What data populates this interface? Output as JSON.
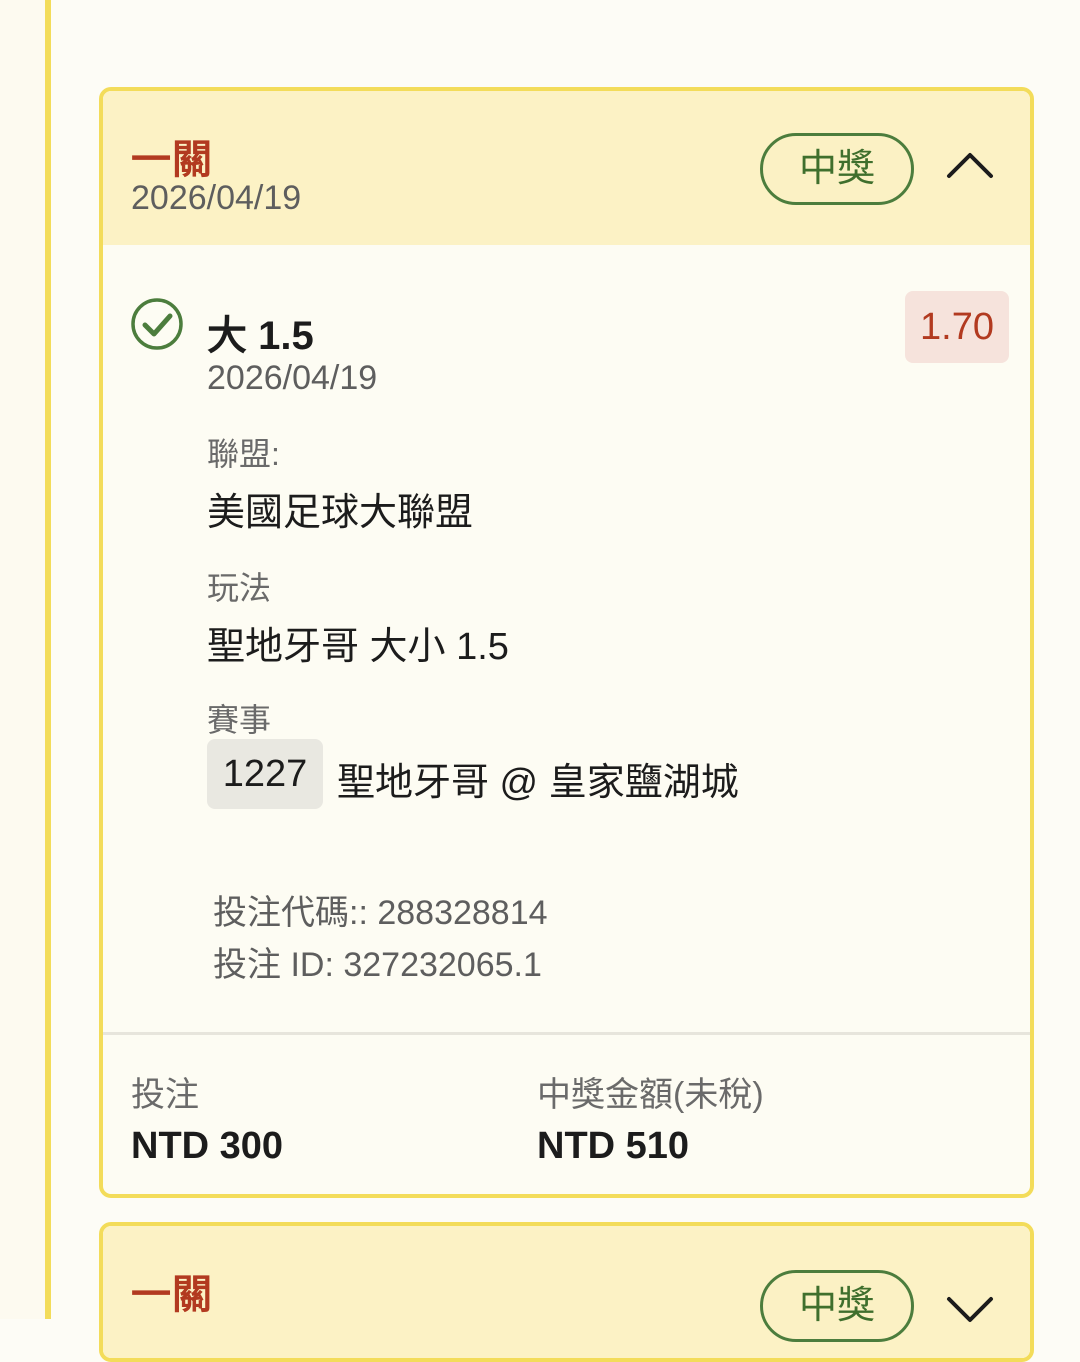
{
  "tickets": [
    {
      "type": "一關",
      "date": "2026/04/19",
      "status": "中獎",
      "expanded": true,
      "selection": {
        "title": "大 1.5",
        "date": "2026/04/19",
        "odds": "1.70",
        "league_label": "聯盟:",
        "league_value": "美國足球大聯盟",
        "market_label": "玩法",
        "market_value": "聖地牙哥 大小 1.5",
        "event_label": "賽事",
        "event_id": "1227",
        "event_name": "聖地牙哥 @ 皇家鹽湖城"
      },
      "bet_code": "投注代碼:: 288328814",
      "bet_id": "投注 ID: 327232065.1",
      "stake_label": "投注",
      "stake_value": "NTD 300",
      "payout_label": "中獎金額(未稅)",
      "payout_value": "NTD 510"
    },
    {
      "type": "一關",
      "status": "中獎",
      "expanded": false
    }
  ],
  "colors": {
    "accent_border": "#f3dc5a",
    "header_bg": "#fcf2c5",
    "win_green": "#4c7d3d",
    "odds_red": "#b23a20"
  },
  "icons": {
    "expanded": "chevron-up-icon",
    "collapsed": "chevron-down-icon",
    "won": "check-circle-icon"
  }
}
